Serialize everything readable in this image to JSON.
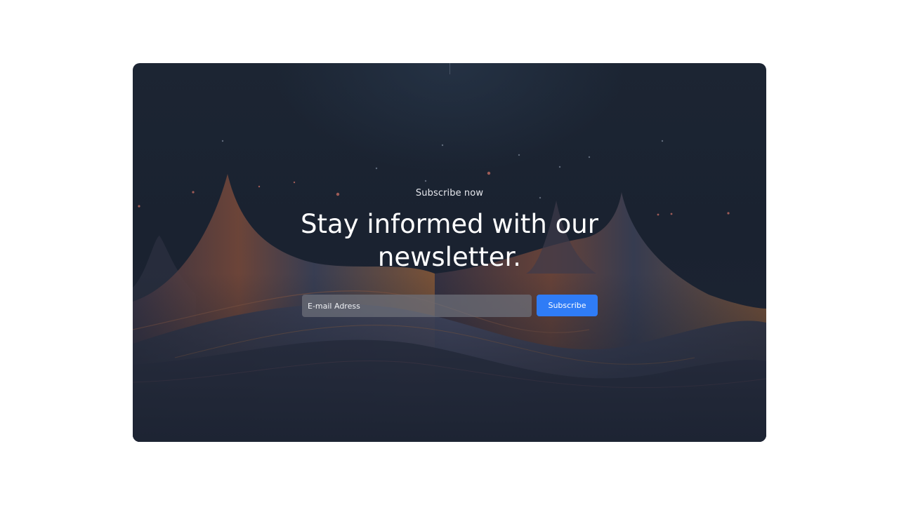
{
  "newsletter": {
    "eyebrow": "Subscribe now",
    "title": "Stay informed with our newsletter.",
    "email_placeholder": "E-mail Adress",
    "email_value": "",
    "subscribe_label": "Subscribe"
  },
  "colors": {
    "page_background": "#ffffff",
    "card_background": "#1c2533",
    "button": "#2f7cf6",
    "input_background": "#6e707a",
    "text": "#ffffff"
  }
}
